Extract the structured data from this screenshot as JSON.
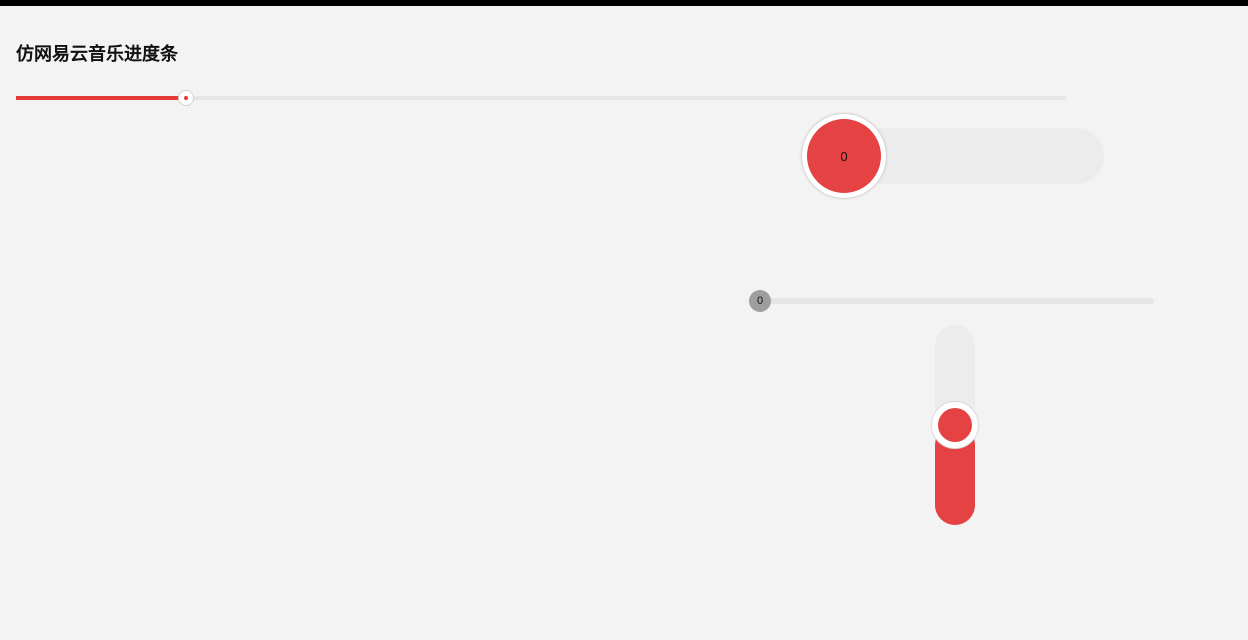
{
  "title": "仿网易云音乐进度条",
  "colors": {
    "accent": "#e53935",
    "bg": "#f3f3f3",
    "track": "#e6e6e6",
    "gray_thumb": "#9e9e9e"
  },
  "slider_music": {
    "value_percent": 16
  },
  "slider_large_pill": {
    "value_label": "0",
    "value_percent": 0
  },
  "slider_mini": {
    "value_label": "0",
    "value_percent": 0
  },
  "slider_vertical": {
    "value_percent": 50
  }
}
